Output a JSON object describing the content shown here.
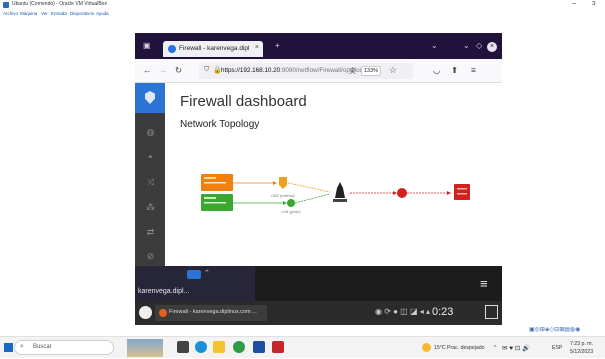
{
  "vbox": {
    "title": "Ubuntu (Corriendo) - Oracle VM VirtualBox",
    "menu": [
      "Archivo",
      "Máquina",
      "Ver",
      "Entrada",
      "Dispositivos",
      "Ayuda"
    ]
  },
  "browser": {
    "tab_title": "Firewall - karenvega.diplin",
    "url_host": "https://192.168.10.20",
    "url_path": ":9090/netflow/Firewall/opaliod",
    "zoom": "133%"
  },
  "page": {
    "title": "Firewall dashboard",
    "subtitle": "Network Topology"
  },
  "topology": {
    "nodes": [
      {
        "id": "lan1",
        "label": "",
        "color": "#f08010"
      },
      {
        "id": "lan2",
        "label": "",
        "color": "#3aa830"
      },
      {
        "id": "dmz",
        "label": "DMZ (external)",
        "color": "#f0a020"
      },
      {
        "id": "lan",
        "label": "LAN (green)",
        "color": "#3aa830"
      },
      {
        "id": "fw",
        "label": "",
        "color": "#222222"
      },
      {
        "id": "internet",
        "label": "",
        "color": "#d02020"
      },
      {
        "id": "remote",
        "label": "",
        "color": "#d02020"
      }
    ]
  },
  "guest": {
    "host_label": "karenvega.dipl...",
    "panel_window": "Firewall - karenvega.diplinux.com ...",
    "clock": "0:23"
  },
  "windows": {
    "search_placeholder": "Buscar",
    "weather": "15°C  Prac. despejado",
    "time": "7:23 p. m.",
    "date": "5/12/2023",
    "lang": "ESP"
  }
}
